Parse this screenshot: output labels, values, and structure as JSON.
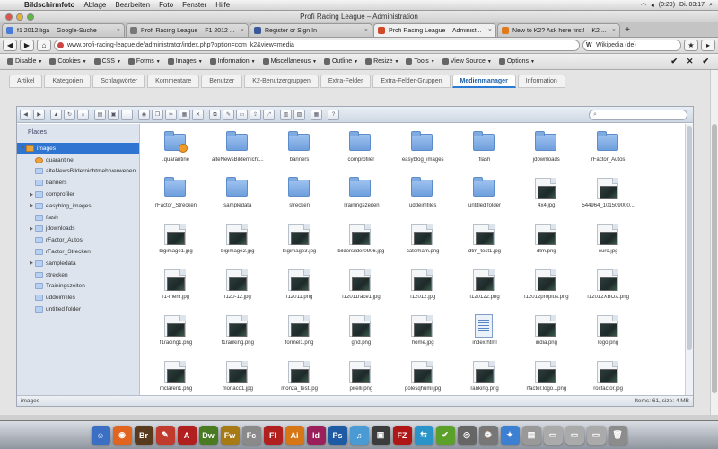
{
  "menubar": {
    "app": "Bildschirmfoto",
    "items": [
      "Ablage",
      "Bearbeiten",
      "Foto",
      "Fenster",
      "Hilfe"
    ],
    "battery": "(0:29)",
    "clock": "Di. 03:17"
  },
  "window": {
    "title": "Profi Racing League – Administration"
  },
  "tabs": [
    {
      "label": "f1 2012 liga – Google-Suche",
      "favicon_color": "#4a7bd8"
    },
    {
      "label": "Profi Racing League – F1 2012 ...",
      "favicon_color": "#777777"
    },
    {
      "label": "Register or Sign In",
      "favicon_color": "#3b5998"
    },
    {
      "label": "Profi Racing League – Administ...",
      "favicon_color": "#d04a2a",
      "active": true
    },
    {
      "label": "New to K2? Ask here first! – K2 ...",
      "favicon_color": "#e07a1a"
    }
  ],
  "nav": {
    "url": "www.profi-racing-league.de/administrator/index.php?option=com_k2&view=media",
    "search_engine": "W",
    "search_placeholder": "Wikipedia (de)"
  },
  "devbar": {
    "items": [
      "Disable",
      "Cookies",
      "CSS",
      "Forms",
      "Images",
      "Information",
      "Miscellaneous",
      "Outline",
      "Resize",
      "Tools",
      "View Source",
      "Options"
    ]
  },
  "k2tabs": [
    "Artikel",
    "Kategorien",
    "Schlagwörter",
    "Kommentare",
    "Benutzer",
    "K2-Benutzergruppen",
    "Extra-Felder",
    "Extra-Felder-Gruppen",
    "Medienmanager",
    "Information"
  ],
  "k2tab_active": "Medienmanager",
  "filemanager": {
    "places_label": "Places",
    "tree": [
      {
        "label": "images",
        "selected": true,
        "kind": "home",
        "expander": "▼",
        "indent": 0
      },
      {
        "label": "quarantine",
        "kind": "quarantine",
        "indent": 1
      },
      {
        "label": "alteNewsBildernichtmehrverwenen",
        "indent": 1
      },
      {
        "label": "banners",
        "indent": 1
      },
      {
        "label": "comprofiler",
        "expander": "▶",
        "indent": 1
      },
      {
        "label": "easyblog_images",
        "expander": "▶",
        "indent": 1
      },
      {
        "label": "flash",
        "indent": 1
      },
      {
        "label": "jdownloads",
        "expander": "▶",
        "indent": 1
      },
      {
        "label": "rFactor_Autos",
        "indent": 1
      },
      {
        "label": "rFactor_Strecken",
        "indent": 1
      },
      {
        "label": "sampledata",
        "expander": "▶",
        "indent": 1
      },
      {
        "label": "strecken",
        "indent": 1
      },
      {
        "label": "Trainingszeiten",
        "indent": 1
      },
      {
        "label": "uddeimfiles",
        "indent": 1
      },
      {
        "label": "untitled folder",
        "indent": 1
      }
    ],
    "items": [
      {
        "name": ".quarantine",
        "type": "folder-q"
      },
      {
        "name": "alteNewsBildernicht...",
        "type": "folder"
      },
      {
        "name": "banners",
        "type": "folder"
      },
      {
        "name": "comprofiler",
        "type": "folder"
      },
      {
        "name": "easyblog_images",
        "type": "folder"
      },
      {
        "name": "flash",
        "type": "folder"
      },
      {
        "name": "jdownloads",
        "type": "folder"
      },
      {
        "name": "rFactor_Autos",
        "type": "folder"
      },
      {
        "name": "rFactor_Strecken",
        "type": "folder"
      },
      {
        "name": "sampledata",
        "type": "folder"
      },
      {
        "name": "strecken",
        "type": "folder"
      },
      {
        "name": "Trainingszeiten",
        "type": "folder"
      },
      {
        "name": "uddeimfiles",
        "type": "folder"
      },
      {
        "name": "untitled folder",
        "type": "folder"
      },
      {
        "name": "4x4.jpg",
        "type": "image"
      },
      {
        "name": "544964_101509000...",
        "type": "image"
      },
      {
        "name": "bigimage1.jpg",
        "type": "image"
      },
      {
        "name": "bigimage2.jpg",
        "type": "image"
      },
      {
        "name": "bigimage3.jpg",
        "type": "image"
      },
      {
        "name": "bildersilder0906.jpg",
        "type": "image"
      },
      {
        "name": "caterham.png",
        "type": "image"
      },
      {
        "name": "dtm_test1.jpg",
        "type": "image"
      },
      {
        "name": "dtm.png",
        "type": "image"
      },
      {
        "name": "euro.jpg",
        "type": "image"
      },
      {
        "name": "f1-mehr.jpg",
        "type": "image"
      },
      {
        "name": "f120-12.jpg",
        "type": "image"
      },
      {
        "name": "f12011.png",
        "type": "image"
      },
      {
        "name": "f12011race1.jpg",
        "type": "image"
      },
      {
        "name": "f12012.jpg",
        "type": "image"
      },
      {
        "name": "f120122.png",
        "type": "image"
      },
      {
        "name": "f12012proplus.png",
        "type": "image"
      },
      {
        "name": "f12012XBOX.png",
        "type": "image"
      },
      {
        "name": "f1racing1.png",
        "type": "image"
      },
      {
        "name": "f1ranking.png",
        "type": "image"
      },
      {
        "name": "formel1.png",
        "type": "image"
      },
      {
        "name": "grid.png",
        "type": "image"
      },
      {
        "name": "home.jpg",
        "type": "image"
      },
      {
        "name": "index.html",
        "type": "doc"
      },
      {
        "name": "india.png",
        "type": "image"
      },
      {
        "name": "logo.png",
        "type": "image"
      },
      {
        "name": "mclaren1.png",
        "type": "image"
      },
      {
        "name": "monaco1.jpg",
        "type": "image"
      },
      {
        "name": "monza_test.jpg",
        "type": "image"
      },
      {
        "name": "pirelli.png",
        "type": "image"
      },
      {
        "name": "polesqhumi.jpg",
        "type": "image"
      },
      {
        "name": "ranking.png",
        "type": "image"
      },
      {
        "name": "rfactor.logo...png",
        "type": "image"
      },
      {
        "name": "rocfactor.jpg",
        "type": "image"
      }
    ],
    "status_path": "images",
    "status_info": "Items: 61, size: 4 MB"
  },
  "dock": [
    {
      "label": "☺",
      "color": "#3a6fc4"
    },
    {
      "label": "◉",
      "color": "#e2651f"
    },
    {
      "label": "Br",
      "color": "#5a3a1e"
    },
    {
      "label": "✎",
      "color": "#c13a2e"
    },
    {
      "label": "A",
      "color": "#b21f1f"
    },
    {
      "label": "Dw",
      "color": "#4a7a22"
    },
    {
      "label": "Fw",
      "color": "#a77a14"
    },
    {
      "label": "Fc",
      "color": "#8a8a8a"
    },
    {
      "label": "Fl",
      "color": "#b21f1f"
    },
    {
      "label": "Ai",
      "color": "#d77614"
    },
    {
      "label": "Id",
      "color": "#9b1f5a"
    },
    {
      "label": "Ps",
      "color": "#1f5aa5"
    },
    {
      "label": "♫",
      "color": "#4a9ad4"
    },
    {
      "label": "▣",
      "color": "#3c3c3c"
    },
    {
      "label": "FZ",
      "color": "#b01616"
    },
    {
      "label": "⇆",
      "color": "#2a93c7"
    },
    {
      "label": "✔",
      "color": "#5aa02a"
    },
    {
      "label": "◎",
      "color": "#666666"
    },
    {
      "label": "⌚",
      "color": "#777777"
    },
    {
      "label": "✦",
      "color": "#3d7fd1"
    },
    {
      "label": "▤",
      "color": "#999999"
    },
    {
      "label": "▭",
      "color": "#aaaaaa"
    },
    {
      "label": "▭",
      "color": "#aaaaaa"
    },
    {
      "label": "▭",
      "color": "#aaaaaa"
    },
    {
      "label": "🗑",
      "color": "#8c8c8c"
    }
  ]
}
